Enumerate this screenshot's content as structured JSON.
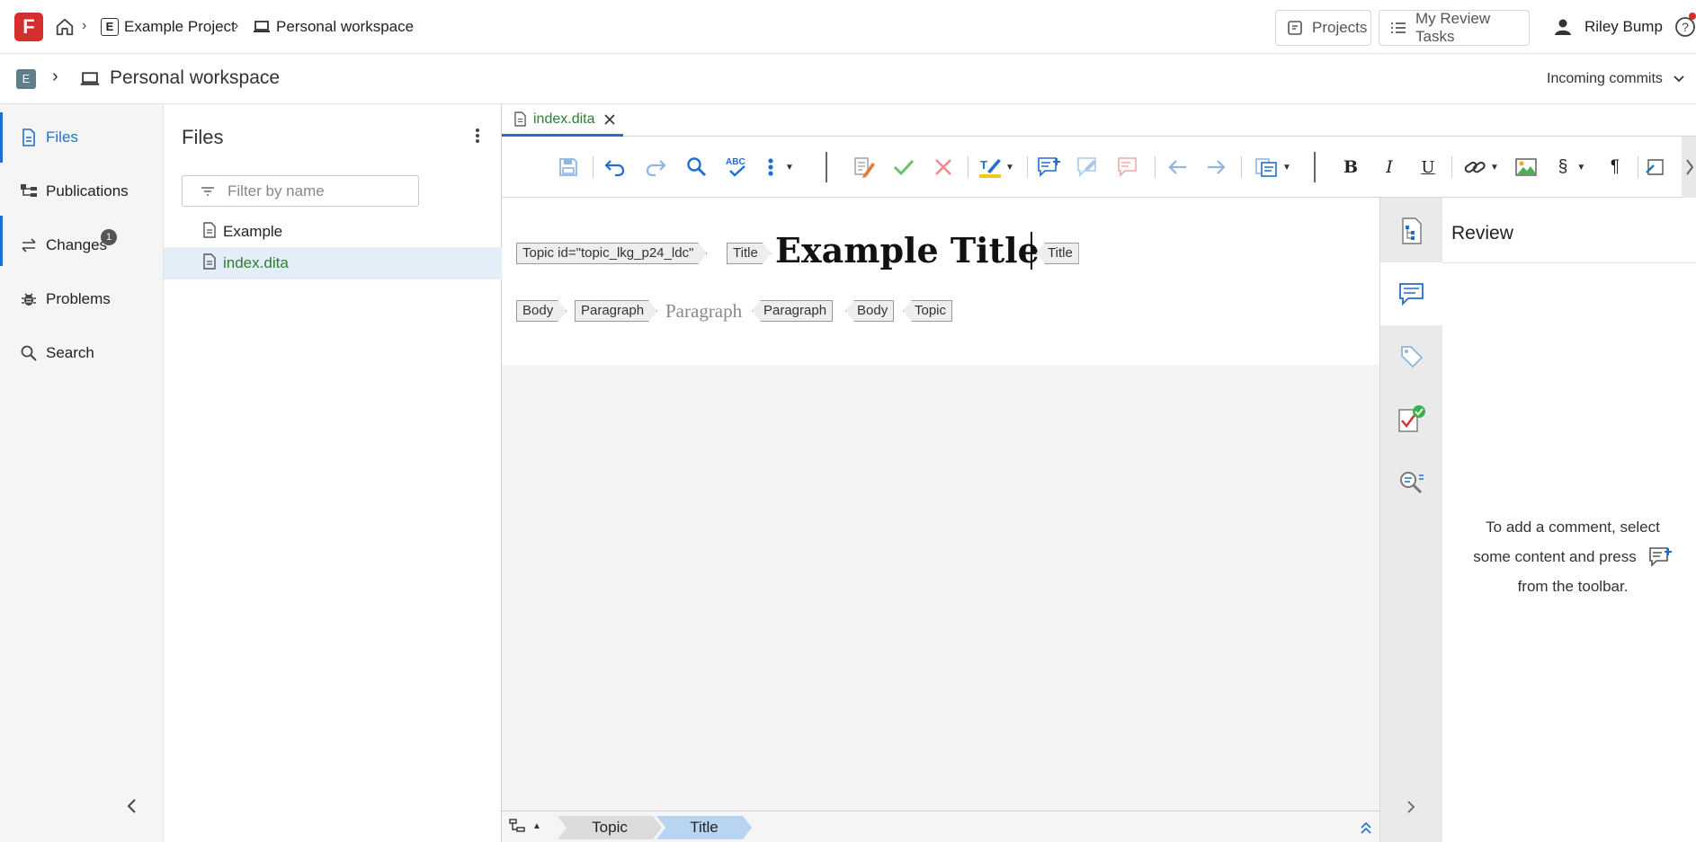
{
  "header": {
    "logo_letter": "F",
    "breadcrumb": [
      "Example Project",
      "Personal workspace"
    ],
    "project_letter": "E",
    "projects_label": "Projects",
    "review_tasks_label": "My Review Tasks",
    "user_name": "Riley Bump"
  },
  "subheader": {
    "project_letter": "E",
    "title": "Personal workspace",
    "incoming_label": "Incoming commits"
  },
  "nav": {
    "items": [
      {
        "label": "Files"
      },
      {
        "label": "Publications"
      },
      {
        "label": "Changes",
        "badge": "1"
      },
      {
        "label": "Problems"
      },
      {
        "label": "Search"
      }
    ]
  },
  "files": {
    "title": "Files",
    "filter_placeholder": "Filter by name",
    "items": [
      "Example",
      "index.dita"
    ]
  },
  "editor": {
    "tab_label": "index.dita",
    "tags": {
      "topic_open": "Topic id=\"topic_lkg_p24_ldc\"",
      "title_open": "Title",
      "title_close": "Title",
      "body_open": "Body",
      "para_open": "Paragraph",
      "para_close": "Paragraph",
      "body_close": "Body",
      "topic_close": "Topic"
    },
    "title_text": "Example Title",
    "paragraph_placeholder": "Paragraph",
    "status_crumbs": [
      "Topic",
      "Title"
    ]
  },
  "review": {
    "title": "Review",
    "message_part1": "To add a comment, select",
    "message_part2": "some content and press",
    "message_part3": "from the toolbar."
  },
  "colors": {
    "accent": "#1f6fd1",
    "logo": "#d32f2f",
    "active_file": "#2e7d32"
  }
}
